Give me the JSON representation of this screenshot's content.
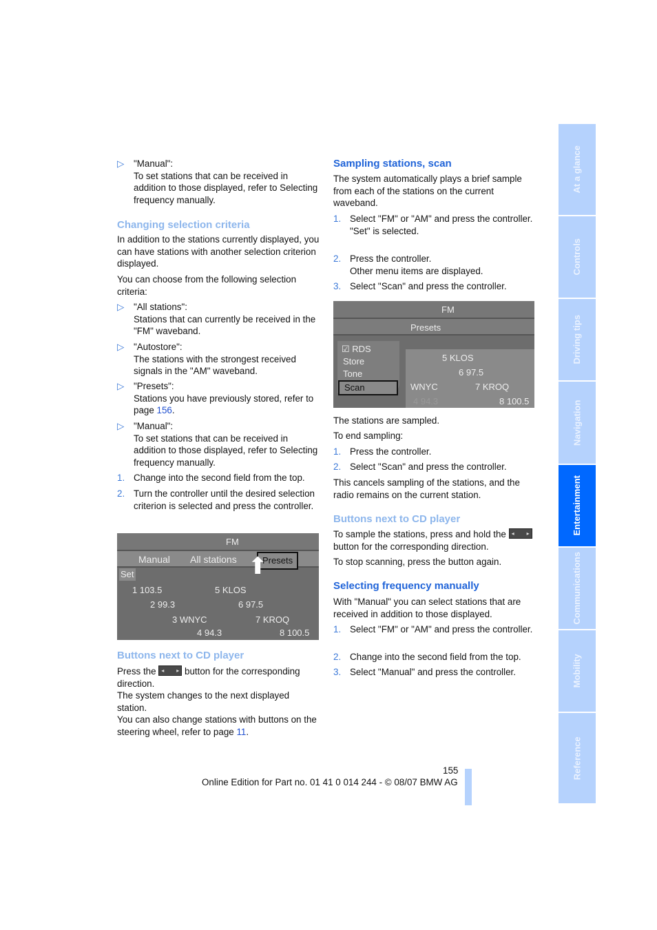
{
  "left": {
    "b1": {
      "marker": "▷",
      "title": "\"Manual\":",
      "text": "To set stations that can be received in addition to those displayed, refer to Selecting frequency manually."
    },
    "h1": "Changing selection criteria",
    "p1": "In addition to the stations currently displayed, you can have stations with another selection criterion displayed.",
    "p2": "You can choose from the following selection criteria:",
    "bullets": [
      {
        "marker": "▷",
        "title": "\"All stations\":",
        "text": "Stations that can currently be received in the \"FM\" waveband."
      },
      {
        "marker": "▷",
        "title": "\"Autostore\":",
        "text": "The stations with the strongest received signals in the \"AM\" waveband."
      },
      {
        "marker": "▷",
        "title": "\"Presets\":",
        "text": "Stations you have previously stored, refer to page ",
        "link": "156",
        "after": "."
      },
      {
        "marker": "▷",
        "title": "\"Manual\":",
        "text": "To set stations that can be received in addition to those displayed, refer to Selecting frequency manually."
      }
    ],
    "steps": [
      {
        "n": "1.",
        "text": "Change into the second field from the top."
      },
      {
        "n": "2.",
        "text": "Turn the controller until the desired selection criterion is selected and press the controller."
      }
    ],
    "shot": {
      "band": "FM",
      "tabs": [
        "Manual",
        "All stations",
        "Presets"
      ],
      "set": "Set",
      "rows": [
        [
          "1 103.5",
          "5 KLOS"
        ],
        [
          "2 99.3",
          "6 97.5"
        ],
        [
          "3 WNYC",
          "7 KROQ"
        ],
        [
          "4 94.3",
          "8 100.5"
        ]
      ]
    },
    "h2": "Buttons next to CD player",
    "p3a": "Press the ",
    "p3b": " button for the corresponding direction.",
    "p4": "The system changes to the next displayed station.",
    "p5": "You can also change stations with buttons on the steering wheel, refer to page ",
    "p5link": "11",
    "p5after": "."
  },
  "right": {
    "h1": "Sampling stations, scan",
    "p1": "The system automatically plays a brief sample from each of the stations on the current waveband.",
    "steps1": [
      {
        "n": "1.",
        "text": "Select \"FM\" or \"AM\" and press the controller.",
        "sub": "\"Set\" is selected."
      },
      {
        "n": "2.",
        "text": "Press the controller.",
        "sub": "Other menu items are displayed."
      },
      {
        "n": "3.",
        "text": "Select \"Scan\" and press the controller."
      }
    ],
    "shot": {
      "band": "FM",
      "presets": "Presets",
      "menu": [
        "RDS",
        "Store",
        "Tone",
        "Scan"
      ],
      "rows": [
        "5 KLOS",
        "6 97.5",
        "WNYC",
        "7 KROQ",
        "4 94.3",
        "8 100.5"
      ]
    },
    "p2": "The stations are sampled.",
    "p3": "To end sampling:",
    "steps2": [
      {
        "n": "1.",
        "text": "Press the controller."
      },
      {
        "n": "2.",
        "text": "Select \"Scan\" and press the controller."
      }
    ],
    "p4": "This cancels sampling of the stations, and the radio remains on the current station.",
    "h2": "Buttons next to CD player",
    "p5a": "To sample the stations, press and hold the ",
    "p5b": " button for the corresponding direction.",
    "p6": "To stop scanning, press the button again.",
    "h3": "Selecting frequency manually",
    "p7": "With \"Manual\" you can select stations that are received in addition to those displayed.",
    "steps3": [
      {
        "n": "1.",
        "text": "Select \"FM\" or \"AM\" and press the controller."
      },
      {
        "n": "2.",
        "text": "Change into the second field from the top."
      },
      {
        "n": "3.",
        "text": "Select \"Manual\" and press the controller."
      }
    ]
  },
  "sidebar": {
    "active": "Entertainment",
    "tabs": [
      "At a glance",
      "Controls",
      "Driving tips",
      "Navigation",
      "Entertainment",
      "Communications",
      "Mobility",
      "Reference"
    ]
  },
  "footer": {
    "page": "155",
    "text": "Online Edition for Part no. 01 41 0 014 244 - © 08/07 BMW AG"
  },
  "colors": {
    "heading_primary": "#1f63d8",
    "heading_secondary": "#8db6ec",
    "sidebar": "#b5d2fd",
    "sidebar_active": "#0068ff"
  }
}
